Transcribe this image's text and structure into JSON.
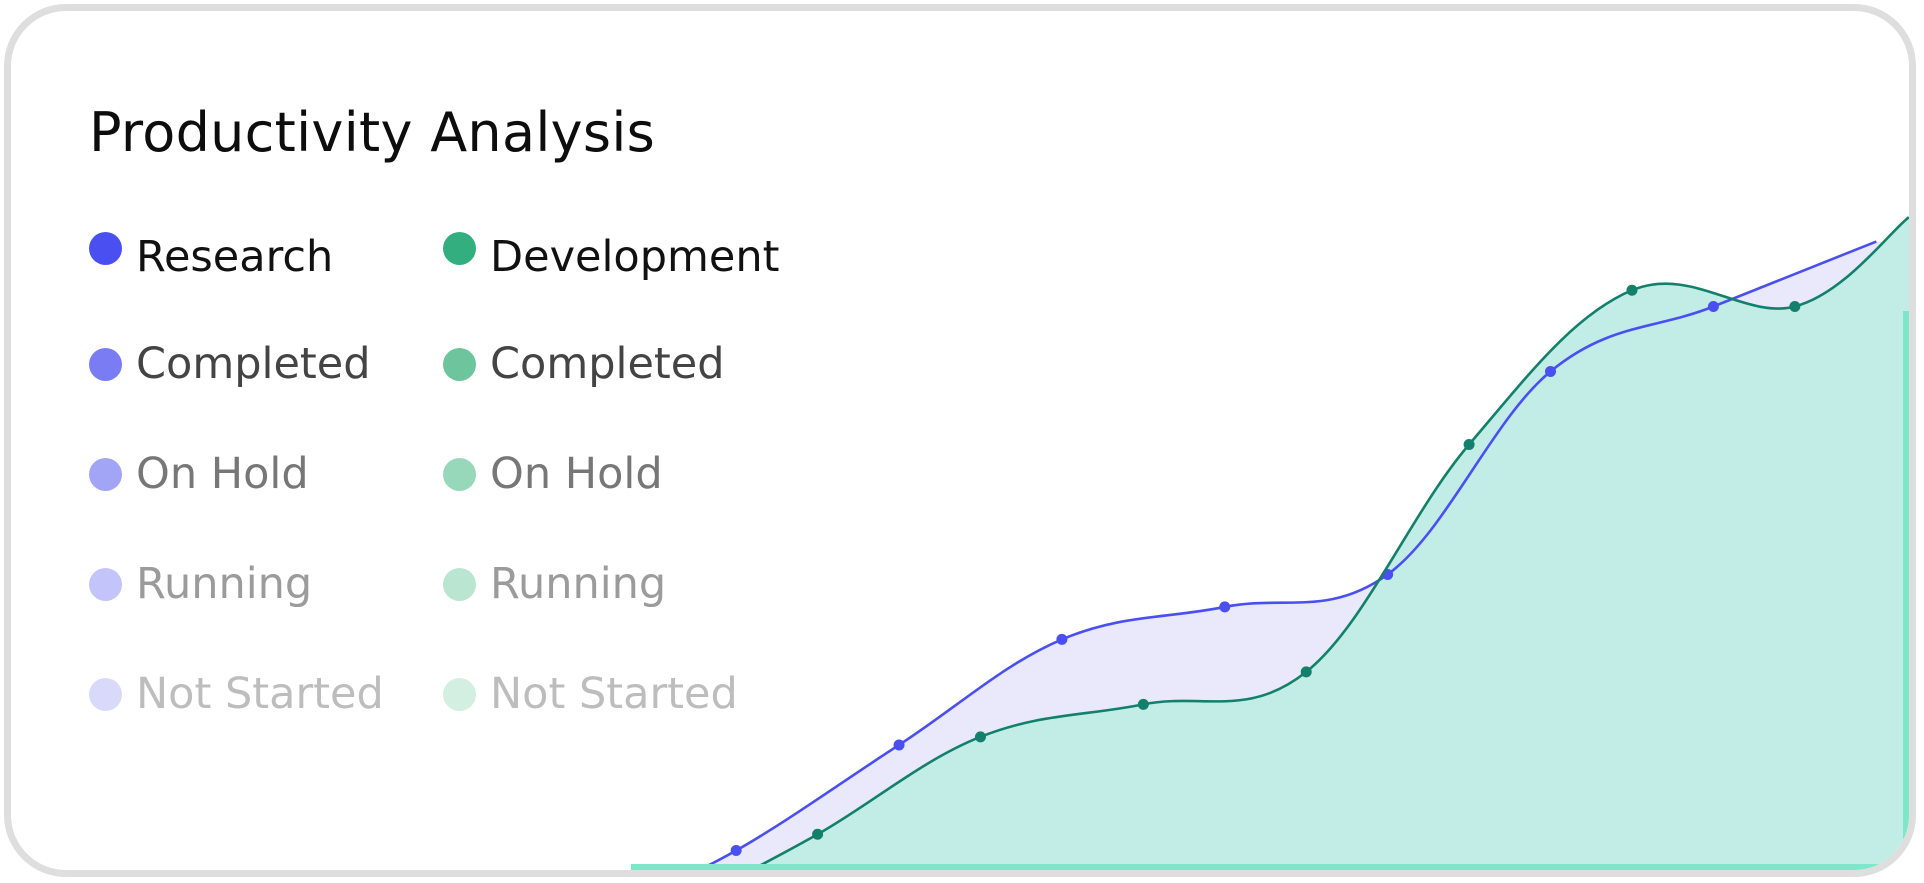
{
  "chart_data": {
    "type": "area",
    "title": "Productivity Analysis",
    "xlabel": "",
    "ylabel": "",
    "ylim": [
      0,
      100
    ],
    "grid": false,
    "axes_visible": false,
    "legend_placement": "top-left",
    "x": [
      0,
      1,
      2,
      3,
      4,
      5,
      6,
      7,
      8,
      9,
      10
    ],
    "series": [
      {
        "name": "Research",
        "color": "#4a4ff2",
        "fill": "#e9e9fb",
        "values": [
          -3,
          4,
          17,
          30,
          34,
          38,
          63,
          71,
          79
        ]
      },
      {
        "name": "Development",
        "color": "#12806a",
        "fill": "#c2ece6",
        "values": [
          -3,
          6,
          18,
          22,
          26,
          54,
          73,
          71,
          82
        ]
      }
    ],
    "research_point_x": [
      1.9,
      3.9,
      5.9,
      7.9,
      9.9,
      11.9,
      13.9,
      15.9,
      17.9
    ],
    "development_point_x": [
      5.9,
      8.3,
      10.3,
      12.3,
      14.3,
      16.3,
      18.3
    ]
  },
  "legend": {
    "left": [
      {
        "label": "Research",
        "dot": "#4a4ff2",
        "text": "#111111"
      },
      {
        "label": "Completed",
        "dot": "#7a7cf3",
        "text": "#444444"
      },
      {
        "label": "On Hold",
        "dot": "#a2a4f6",
        "text": "#777777"
      },
      {
        "label": "Running",
        "dot": "#c3c4f9",
        "text": "#9b9b9b"
      },
      {
        "label": "Not Started",
        "dot": "#d9daf9",
        "text": "#bdbdbd"
      }
    ],
    "right": [
      {
        "label": "Development",
        "dot": "#33ae7f",
        "text": "#111111"
      },
      {
        "label": "Completed",
        "dot": "#6cc59c",
        "text": "#444444"
      },
      {
        "label": "On Hold",
        "dot": "#97d8bb",
        "text": "#777777"
      },
      {
        "label": "Running",
        "dot": "#b9e5d1",
        "text": "#9b9b9b"
      },
      {
        "label": "Not Started",
        "dot": "#d2efe2",
        "text": "#bdbdbd"
      }
    ]
  },
  "colors": {
    "card_border": "#dedede",
    "bottom_accent": "#7ee7c9"
  }
}
